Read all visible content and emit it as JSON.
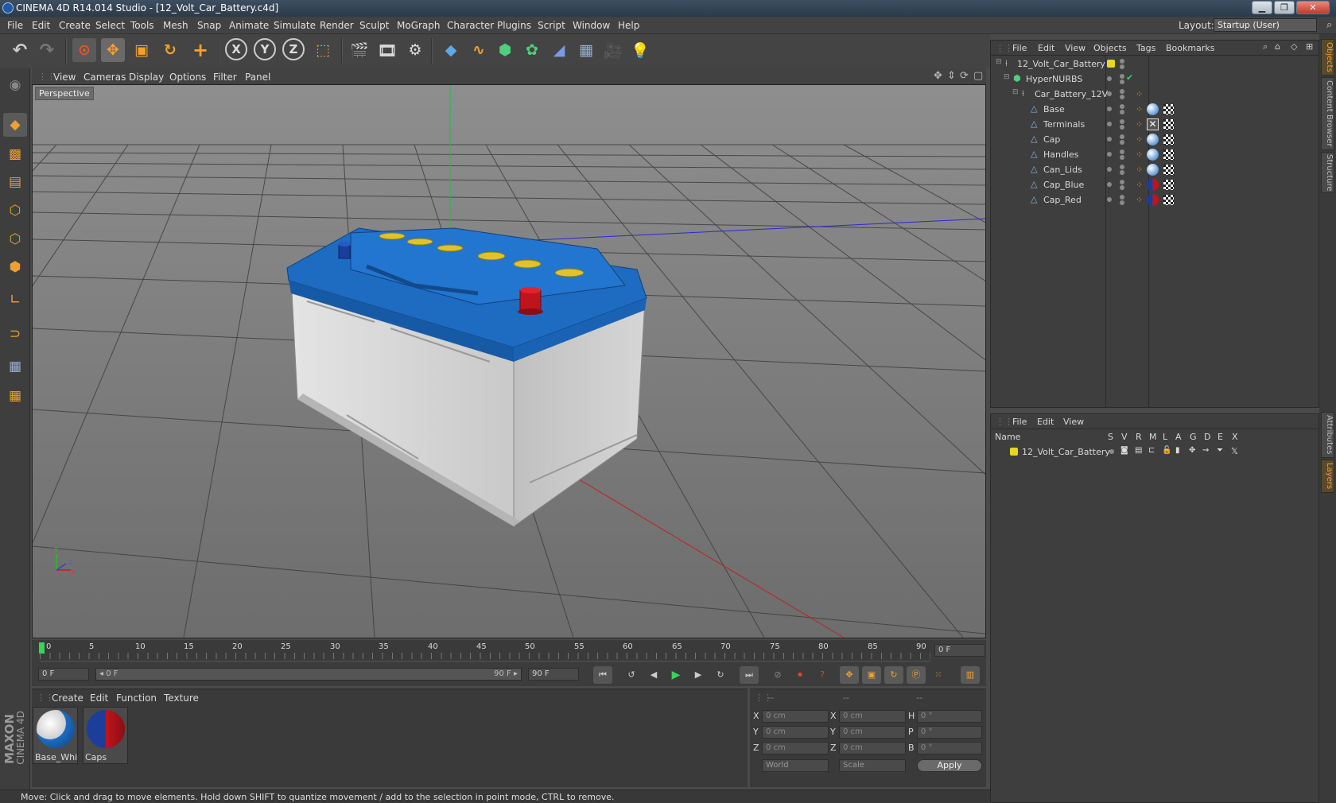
{
  "window": {
    "title": "CINEMA 4D R14.014 Studio - [12_Volt_Car_Battery.c4d]",
    "minimize": "▁",
    "maximize": "❐",
    "close": "✕"
  },
  "menu": {
    "items": [
      "File",
      "Edit",
      "Create",
      "Select",
      "Tools",
      "Mesh",
      "Snap",
      "Animate",
      "Simulate",
      "Render",
      "Sculpt",
      "MoGraph",
      "Character",
      "Plugins",
      "Script",
      "Window",
      "Help"
    ],
    "layout_label": "Layout:",
    "layout_value": "Startup (User)"
  },
  "viewport": {
    "menu": [
      "View",
      "Cameras",
      "Display",
      "Options",
      "Filter",
      "Panel"
    ],
    "label": "Perspective",
    "axis_x": "X",
    "axis_y": "Y",
    "axis_z": "Z"
  },
  "timeline": {
    "ticks": [
      "0",
      "5",
      "10",
      "15",
      "20",
      "25",
      "30",
      "35",
      "40",
      "45",
      "50",
      "55",
      "60",
      "65",
      "70",
      "75",
      "80",
      "85",
      "90"
    ],
    "current_frame": "0 F",
    "start_field": "0 F",
    "range_left": "◂ 0 F",
    "range_right": "90 F ▸",
    "end_field": "90 F"
  },
  "materials": {
    "menu": [
      "Create",
      "Edit",
      "Function",
      "Texture"
    ],
    "items": [
      {
        "name": "Base_White"
      },
      {
        "name": "Caps"
      }
    ]
  },
  "coords": {
    "header": [
      "--",
      "--",
      "--"
    ],
    "rows": [
      {
        "a": "X",
        "av": "0 cm",
        "b": "X",
        "bv": "0 cm",
        "c": "H",
        "cv": "0 °"
      },
      {
        "a": "Y",
        "av": "0 cm",
        "b": "Y",
        "bv": "0 cm",
        "c": "P",
        "cv": "0 °"
      },
      {
        "a": "Z",
        "av": "0 cm",
        "b": "Z",
        "bv": "0 cm",
        "c": "B",
        "cv": "0 °"
      }
    ],
    "world": "World",
    "scale": "Scale",
    "apply": "Apply"
  },
  "objects": {
    "menu": [
      "File",
      "Edit",
      "View",
      "Objects",
      "Tags",
      "Bookmarks"
    ],
    "tree": [
      {
        "name": "12_Volt_Car_Battery",
        "level": 0
      },
      {
        "name": "HyperNURBS",
        "level": 1
      },
      {
        "name": "Car_Battery_12V",
        "level": 2
      },
      {
        "name": "Base",
        "level": 3
      },
      {
        "name": "Terminals",
        "level": 3
      },
      {
        "name": "Cap",
        "level": 3
      },
      {
        "name": "Handles",
        "level": 3
      },
      {
        "name": "Can_Lids",
        "level": 3
      },
      {
        "name": "Cap_Blue",
        "level": 3
      },
      {
        "name": "Cap_Red",
        "level": 3
      }
    ]
  },
  "layers": {
    "menu": [
      "File",
      "Edit",
      "View"
    ],
    "columns": [
      "Name",
      "S",
      "V",
      "R",
      "M",
      "L",
      "A",
      "G",
      "D",
      "E",
      "X"
    ],
    "rows": [
      {
        "name": "12_Volt_Car_Battery"
      }
    ]
  },
  "right_tabs": [
    "Objects",
    "Content Browser",
    "Structure",
    "Attributes",
    "Layers"
  ],
  "status": "Move: Click and drag to move elements. Hold down SHIFT to quantize movement / add to the selection in point mode, CTRL to remove.",
  "brand": {
    "maxon": "MAXON",
    "c4d": "CINEMA 4D"
  },
  "colors": {
    "accent": "#f0a030",
    "battery_top": "#1f6fc4",
    "terminal_red": "#c0141c"
  }
}
